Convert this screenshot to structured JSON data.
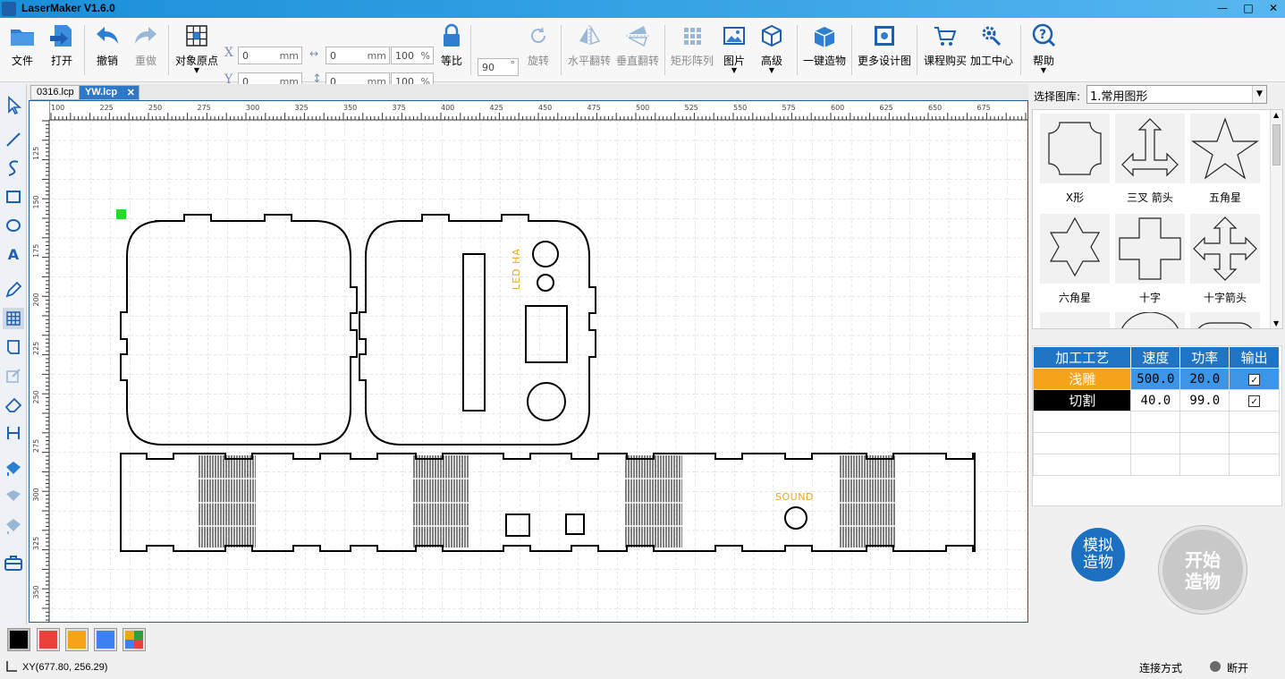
{
  "window": {
    "title": "LaserMaker V1.6.0",
    "min": "—",
    "max": "□",
    "close": "✕"
  },
  "toolbar": {
    "file": "文件",
    "open": "打开",
    "undo": "撤销",
    "redo": "重做",
    "origin": "对象原点",
    "ratio": "等比",
    "rotate": "旋转",
    "hflip": "水平翻转",
    "vflip": "垂直翻转",
    "array": "矩形阵列",
    "image": "图片",
    "advanced": "高级",
    "oneclick": "一键造物",
    "moredesign": "更多设计图",
    "course": "课程购买",
    "center": "加工中心",
    "help": "帮助",
    "x_label": "X",
    "y_label": "Y",
    "x_value": "0",
    "y_value": "0",
    "w_value": "0",
    "h_value": "0",
    "unit": "mm",
    "w_pct": "100",
    "h_pct": "100",
    "pct": "%",
    "angle": "90",
    "deg": "°"
  },
  "tabs": [
    {
      "label": "0316.lcp"
    },
    {
      "label": "YW.lcp",
      "close": "✕"
    }
  ],
  "ruler": {
    "top": [
      "100",
      "225",
      "250",
      "275",
      "300",
      "325",
      "350",
      "375",
      "400",
      "425",
      "450",
      "475",
      "500",
      "525",
      "550",
      "575",
      "600",
      "625",
      "650",
      "675"
    ],
    "left": [
      "125",
      "150",
      "175",
      "200",
      "225",
      "250",
      "275",
      "300",
      "325",
      "350"
    ]
  },
  "canvas": {
    "led_text": "LED  HA",
    "sound_text": "SOUND"
  },
  "right_panel": {
    "lib_label": "选择图库:",
    "lib_value": "1.常用图形",
    "shapes": [
      "X形",
      "三叉 箭头",
      "五角星",
      "六角星",
      "十字",
      "十字箭头"
    ]
  },
  "process_table": {
    "headers": [
      "加工工艺",
      "速度",
      "功率",
      "输出"
    ],
    "rows": [
      {
        "name": "浅雕",
        "speed": "500.0",
        "power": "20.0",
        "color": "#f5a31a"
      },
      {
        "name": "切割",
        "speed": "40.0",
        "power": "99.0",
        "color": "#000000"
      }
    ]
  },
  "buttons": {
    "simulate": "模拟\n造物",
    "start": "开始\n造物"
  },
  "colors": [
    "#000000",
    "#e8403a",
    "#f5a31a",
    "#3b82f0",
    "multi"
  ],
  "status": {
    "coords": "XY(677.80, 256.29)",
    "conn_label": "连接方式",
    "conn_state": "断开"
  }
}
